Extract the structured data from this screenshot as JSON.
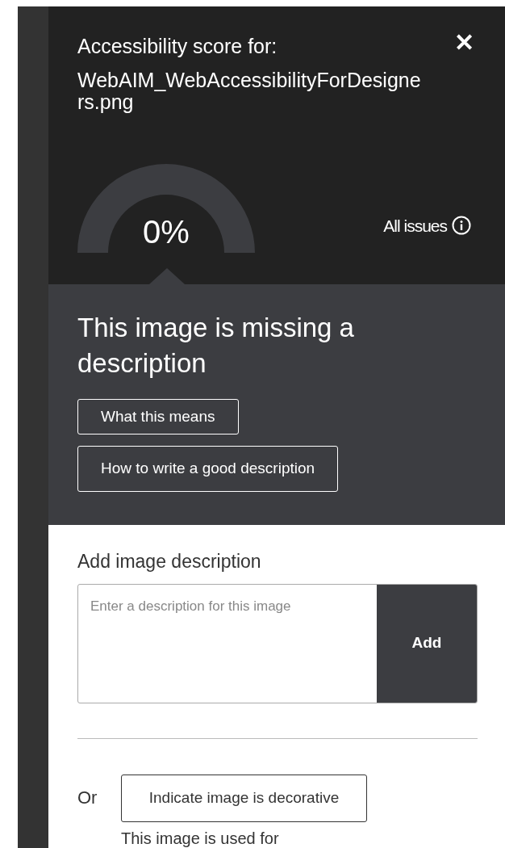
{
  "header": {
    "title": "Accessibility score for:",
    "filename": "WebAIM_WebAccessibilityForDesigners.png",
    "close": "✕"
  },
  "score": {
    "value": "0%"
  },
  "all_issues": "All issues",
  "issue": {
    "heading": "This image is missing a description",
    "buttons": [
      "What this means",
      "How to write a good description"
    ]
  },
  "description": {
    "label": "Add image description",
    "placeholder": "Enter a description for this image",
    "button": "Add"
  },
  "decorative": {
    "or": "Or",
    "button": "Indicate image is decorative",
    "note": "This image is used for"
  }
}
